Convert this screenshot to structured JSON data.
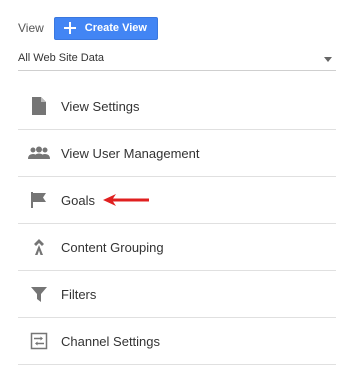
{
  "header": {
    "view_label": "View",
    "create_button_label": "Create View",
    "accent_color": "#4285f4"
  },
  "view_selector": {
    "selected": "All Web Site Data"
  },
  "menu": {
    "items": [
      {
        "label": "View Settings",
        "icon": "document-icon"
      },
      {
        "label": "View User Management",
        "icon": "users-icon"
      },
      {
        "label": "Goals",
        "icon": "flag-icon",
        "annotated": true
      },
      {
        "label": "Content Grouping",
        "icon": "content-grouping-icon"
      },
      {
        "label": "Filters",
        "icon": "filter-icon"
      },
      {
        "label": "Channel Settings",
        "icon": "channel-settings-icon"
      }
    ]
  },
  "annotation": {
    "type": "arrow",
    "color": "#e02020"
  }
}
